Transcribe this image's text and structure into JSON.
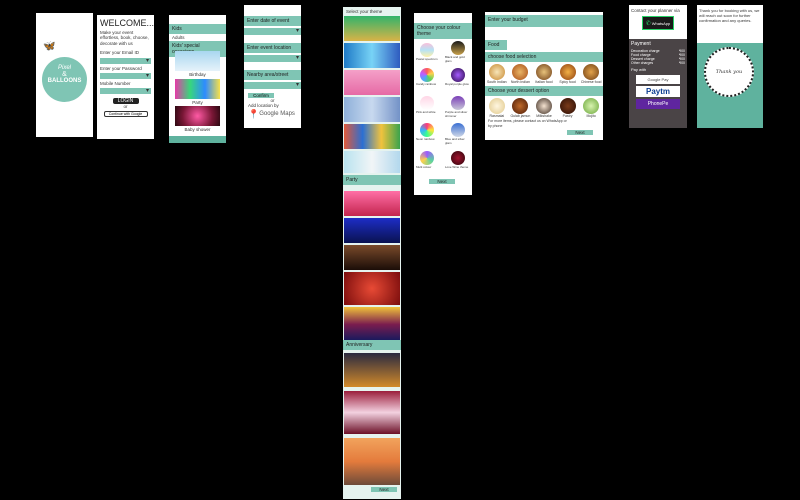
{
  "splash": {
    "brand_top": "Pixel",
    "brand_amp": "&",
    "brand_bottom": "BALLOONS"
  },
  "login": {
    "welcome": "WELCOME...",
    "intro": "Make your event effortless, book, choose, decorate with us",
    "email_label": "Enter your Email ID",
    "password_label": "Enter your Password",
    "mobile_label": "Mobile Number",
    "login_button": "LOGIN",
    "or": "or",
    "google_button": "Continue with Google"
  },
  "events": {
    "tab1": "Kids",
    "tab2": "Adults",
    "section": "Kids' special occasions",
    "captions": [
      "Birthday",
      "Party",
      "Baby shower"
    ]
  },
  "location": {
    "date_label": "Enter date of event",
    "event_location": "Enter event location",
    "nearby": "Nearby area/street",
    "confirm": "Confirm",
    "or": "or",
    "maps_hint": "Add location by",
    "maps": "Google Maps"
  },
  "themes": {
    "title": "Select your theme",
    "party_header": "Party",
    "anniversary_header": "Anniversary",
    "next": "Next"
  },
  "colours": {
    "title": "Choose your colour theme",
    "items": [
      "Pastel spectrum",
      "Black and gold glam",
      "Candy rainbow",
      "Royal purple glow",
      "Pink and white",
      "Purple and silver shimmer",
      "Neon rainbow",
      "Blue and silver glam",
      "Multi colour",
      "Love Wine theme"
    ],
    "next": "Next"
  },
  "food": {
    "title": "Enter your budget",
    "budget_label": "Food",
    "choose_food": "choose food selection",
    "foods": [
      "South Indian",
      "North Indian",
      "Italian food",
      "Spicy food",
      "Chinese food"
    ],
    "desserts_label": "Choose your dessert option",
    "desserts": [
      "Rasmalai",
      "Gulab jamun",
      "Milkshake",
      "Pastry",
      "Mojito"
    ],
    "note": "For more items, please contact us on WhatsApp or by phone",
    "next": "Next"
  },
  "payment": {
    "title": "Contact your planner via",
    "whatsapp": "WhatsApp",
    "payment_label": "Payment",
    "lines": [
      [
        "Decoration charge",
        "₹00"
      ],
      [
        "Food charge",
        "₹00"
      ],
      [
        "Dessert charge",
        "₹00"
      ],
      [
        "Other charges",
        "₹00"
      ]
    ],
    "pay_with": "Pay with",
    "options": [
      "Google Pay",
      "Paytm",
      "PhonePe"
    ]
  },
  "thanks": {
    "message": "Thank you for booking with us, we will reach out soon for further confirmation and any queries.",
    "script": "Thank you"
  },
  "colors": {
    "accent": "#7fc5b4",
    "dark_accent": "#5fb29e",
    "paytm": "#0b3d91",
    "phonepe": "#5f259f"
  }
}
